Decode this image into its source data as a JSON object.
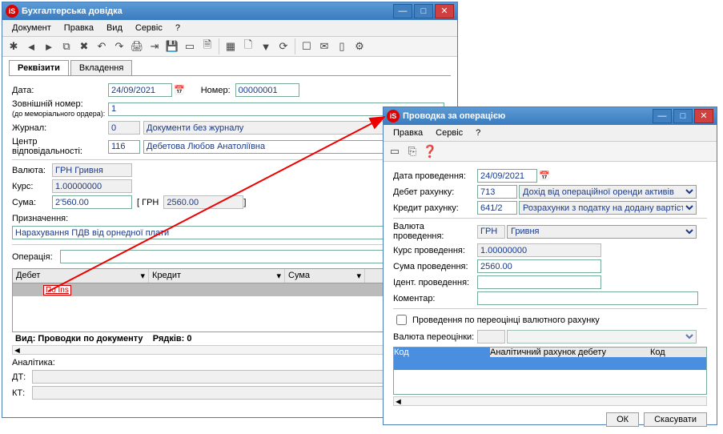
{
  "main": {
    "title": "Бухгалтерська довідка",
    "menu": [
      "Документ",
      "Правка",
      "Вид",
      "Сервіс",
      "?"
    ],
    "tabs": {
      "t1": "Реквізити",
      "t2": "Вкладення"
    },
    "labels": {
      "date": "Дата:",
      "number": "Номер:",
      "ext_number": "Зовнішній номер:",
      "ext_number_sub": "(до меморіального ордера):",
      "journal": "Журнал:",
      "responsibility": "Центр відповідальності:",
      "currency": "Валюта:",
      "rate": "Курс:",
      "sum": "Сума:",
      "sum_curr": "ГРН",
      "purpose": "Призначення:",
      "operation": "Операція:",
      "col_debit": "Дебет",
      "col_credit": "Кредит",
      "col_sum": "Сума",
      "view_status": "Вид: Проводки по документу",
      "rows_status": "Рядків: 0",
      "analytics": "Аналітика:",
      "dt": "ДТ:",
      "kt": "КТ:",
      "ins": "По Ins"
    },
    "values": {
      "date": "24/09/2021",
      "number": "00000001",
      "ext_number": "1",
      "journal_code": "0",
      "journal_name": "Документи без журналу",
      "resp_code": "116",
      "resp_name": "Дебетова Любов Анатоліївна",
      "currency": "ГРН Гривня",
      "rate": "1.00000000",
      "sum": "2'560.00",
      "sum_uah": "2560.00",
      "purpose": "Нарахування ПДВ від орнедної плати"
    }
  },
  "dialog": {
    "title": "Проводка за операцією",
    "menu": [
      "Правка",
      "Сервіс",
      "?"
    ],
    "labels": {
      "date": "Дата проведення:",
      "debit": "Дебет рахунку:",
      "credit": "Кредит рахунку:",
      "currency": "Валюта проведення:",
      "rate": "Курс проведення:",
      "sum": "Сума проведення:",
      "ident": "Ідент. проведення:",
      "comment": "Коментар:",
      "reval": "Проведення по переоцінці валютного рахунку",
      "reval_curr": "Валюта переоцінки:",
      "col_code": "Код",
      "col_analytic": "Аналітичний рахунок дебету",
      "col_code2": "Код",
      "ok": "ОК",
      "cancel": "Скасувати"
    },
    "values": {
      "date": "24/09/2021",
      "debit_code": "713",
      "debit_name": "Дохід від операційної оренди активів",
      "credit_code": "641/2",
      "credit_name": "Розрахунки з податку на додану вартість",
      "curr_code": "ГРН",
      "curr_name": "Гривня",
      "rate": "1.00000000",
      "sum": "2560.00"
    }
  }
}
